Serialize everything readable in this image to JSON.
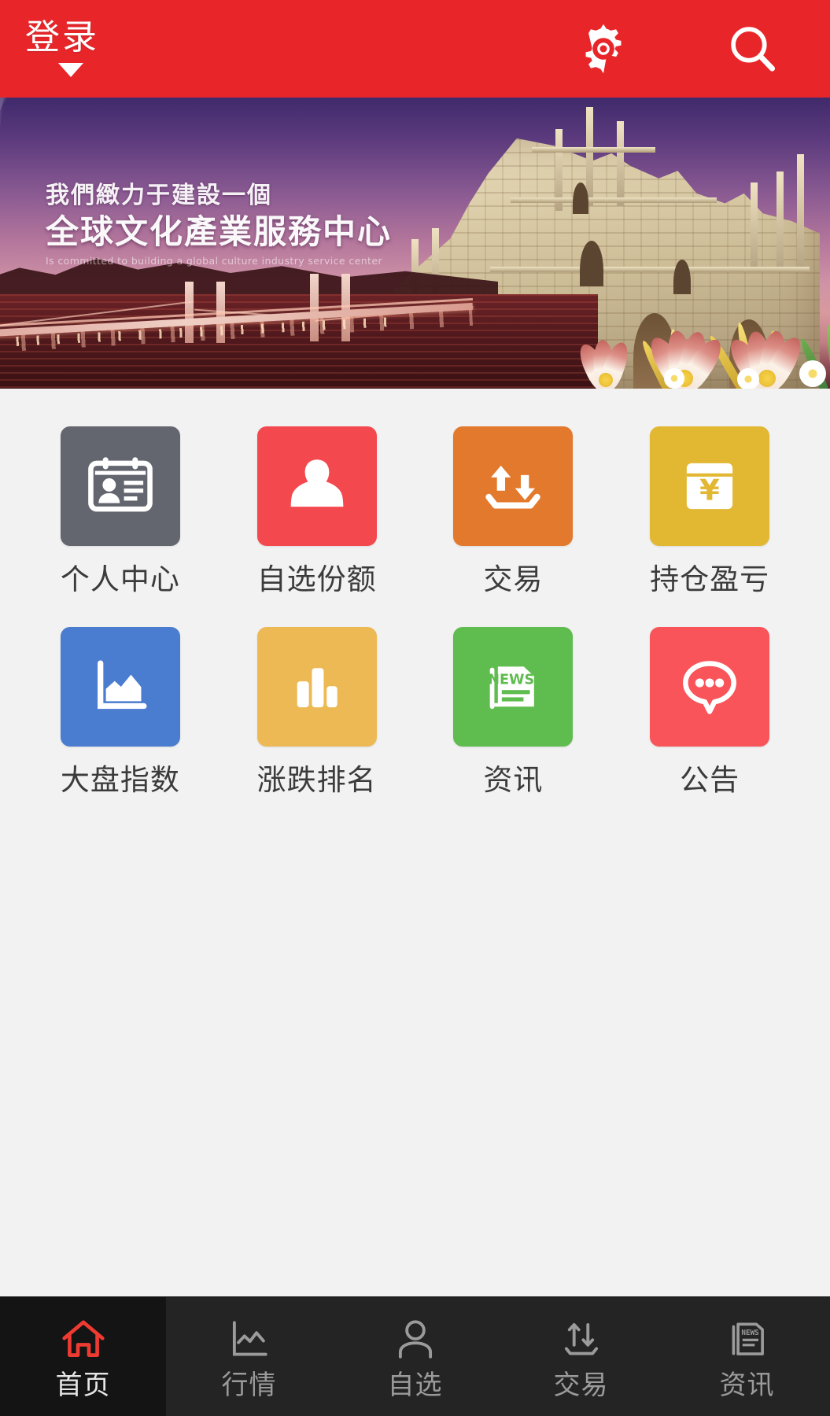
{
  "header": {
    "login_label": "登录",
    "caret_icon": "triangle-down-icon",
    "gear_icon": "gear-icon",
    "search_icon": "search-icon",
    "background_color": "#e8262a"
  },
  "banner": {
    "headline_line1": "我們緻力于建設一個",
    "headline_line2": "全球文化產業服務中心",
    "subtitle": "Is committed to building a global culture industry service center",
    "scene": "ruins-of-st-pauls-macau"
  },
  "grid": {
    "items": [
      {
        "label": "个人中心",
        "icon": "id-card-icon",
        "color": "#63666f"
      },
      {
        "label": "自选份额",
        "icon": "user-icon",
        "color": "#f4484f"
      },
      {
        "label": "交易",
        "icon": "transfer-in-icon",
        "color": "#e2792c"
      },
      {
        "label": "持仓盈亏",
        "icon": "yen-card-icon",
        "color": "#e2b731"
      },
      {
        "label": "大盘指数",
        "icon": "area-chart-icon",
        "color": "#4a7cd0"
      },
      {
        "label": "涨跌排名",
        "icon": "bar-chart-icon",
        "color": "#edb954"
      },
      {
        "label": "资讯",
        "icon": "news-icon",
        "color": "#5fbc4e"
      },
      {
        "label": "公告",
        "icon": "chat-bubble-icon",
        "color": "#f9545a"
      }
    ]
  },
  "tabbar": {
    "active_color": "#ee3b32",
    "items": [
      {
        "label": "首页",
        "icon": "home-icon",
        "active": true
      },
      {
        "label": "行情",
        "icon": "line-chart-icon",
        "active": false
      },
      {
        "label": "自选",
        "icon": "person-icon",
        "active": false
      },
      {
        "label": "交易",
        "icon": "transfer-in-icon",
        "active": false
      },
      {
        "label": "资讯",
        "icon": "news-icon",
        "active": false
      }
    ]
  }
}
